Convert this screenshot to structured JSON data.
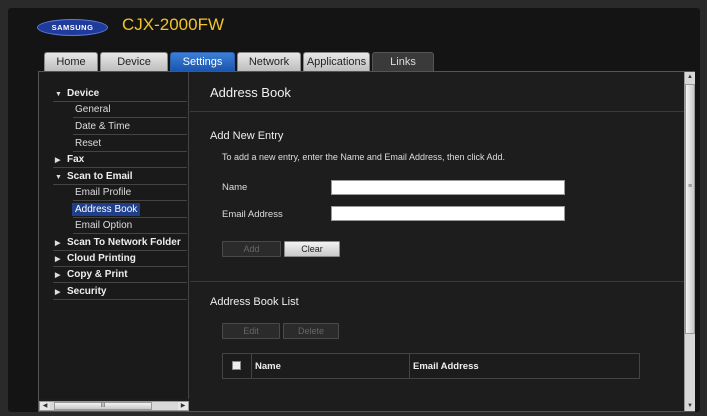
{
  "header": {
    "brand": "SAMSUNG",
    "model": "CJX-2000FW"
  },
  "tabs": [
    {
      "label": "Home",
      "w": 52
    },
    {
      "label": "Device",
      "w": 66
    },
    {
      "label": "Settings",
      "w": 63,
      "active": true
    },
    {
      "label": "Network",
      "w": 62
    },
    {
      "label": "Applications",
      "w": 65
    },
    {
      "label": "Links",
      "w": 60
    }
  ],
  "sidebar": {
    "items": [
      {
        "label": "Device",
        "type": "cat",
        "expanded": true
      },
      {
        "label": "General",
        "type": "sub"
      },
      {
        "label": "Date & Time",
        "type": "sub"
      },
      {
        "label": "Reset",
        "type": "sub"
      },
      {
        "label": "Fax",
        "type": "cat",
        "expanded": false
      },
      {
        "label": "Scan to Email",
        "type": "cat",
        "expanded": true
      },
      {
        "label": "Email Profile",
        "type": "sub"
      },
      {
        "label": "Address Book",
        "type": "sub",
        "selected": true
      },
      {
        "label": "Email Option",
        "type": "sub"
      },
      {
        "label": "Scan To Network Folder",
        "type": "cat",
        "expanded": false
      },
      {
        "label": "Cloud Printing",
        "type": "cat",
        "expanded": false
      },
      {
        "label": "Copy & Print",
        "type": "cat",
        "expanded": false
      },
      {
        "label": "Security",
        "type": "cat",
        "expanded": false
      }
    ],
    "hscroll_thumb": "III"
  },
  "main": {
    "title": "Address Book",
    "add_entry": {
      "title": "Add New Entry",
      "instructions": "To add a new entry, enter the Name and Email Address, then click Add.",
      "name_label": "Name",
      "name_value": "",
      "email_label": "Email Address",
      "email_value": "",
      "add_label": "Add",
      "clear_label": "Clear"
    },
    "list": {
      "title": "Address Book List",
      "edit_label": "Edit",
      "delete_label": "Delete",
      "columns": [
        "Name",
        "Email Address"
      ]
    }
  },
  "colors": {
    "accent": "#f3c32a",
    "tab_active": "#1b55b0",
    "selection": "#1f3f8a"
  },
  "icons": {
    "expanded": "triangle-down",
    "collapsed": "triangle-right",
    "vgrip": "≡"
  }
}
